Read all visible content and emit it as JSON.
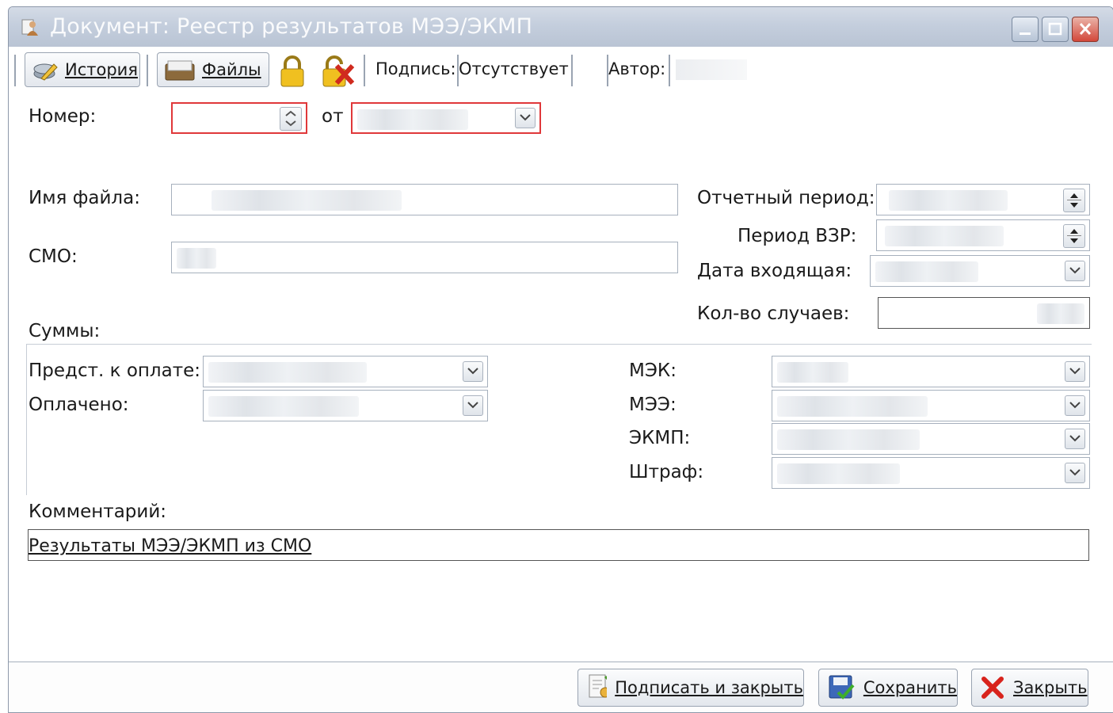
{
  "window": {
    "title": "Документ: Реестр результатов МЭЭ/ЭКМП"
  },
  "toolbar": {
    "history_label": "История",
    "files_label": "Файлы",
    "signature_label": "Подпись:",
    "signature_value": "Отсутствует",
    "author_label": "Автор:"
  },
  "form": {
    "number_label": "Номер:",
    "from_label": "от",
    "filename_label": "Имя файла:",
    "smo_label": "СМО:",
    "report_period_label": "Отчетный период:",
    "vzr_period_label": "Период ВЗР:",
    "incoming_date_label": "Дата входящая:",
    "cases_count_label": "Кол-во случаев:",
    "sums_label": "Суммы:",
    "presented_label": "Предст. к оплате:",
    "paid_label": "Оплачено:",
    "mek_label": "МЭК:",
    "mee_label": "МЭЭ:",
    "ekmp_label": "ЭКМП:",
    "fine_label": "Штраф:",
    "comment_label": "Комментарий:",
    "comment_value": "Результаты МЭЭ/ЭКМП из СМО"
  },
  "buttons": {
    "sign_close": "Подписать и закрыть",
    "save": "Сохранить",
    "close": "Закрыть"
  },
  "colors": {
    "error_border": "#e0383a",
    "title_bar": "#c4cedd",
    "close_button": "#d3473a"
  }
}
